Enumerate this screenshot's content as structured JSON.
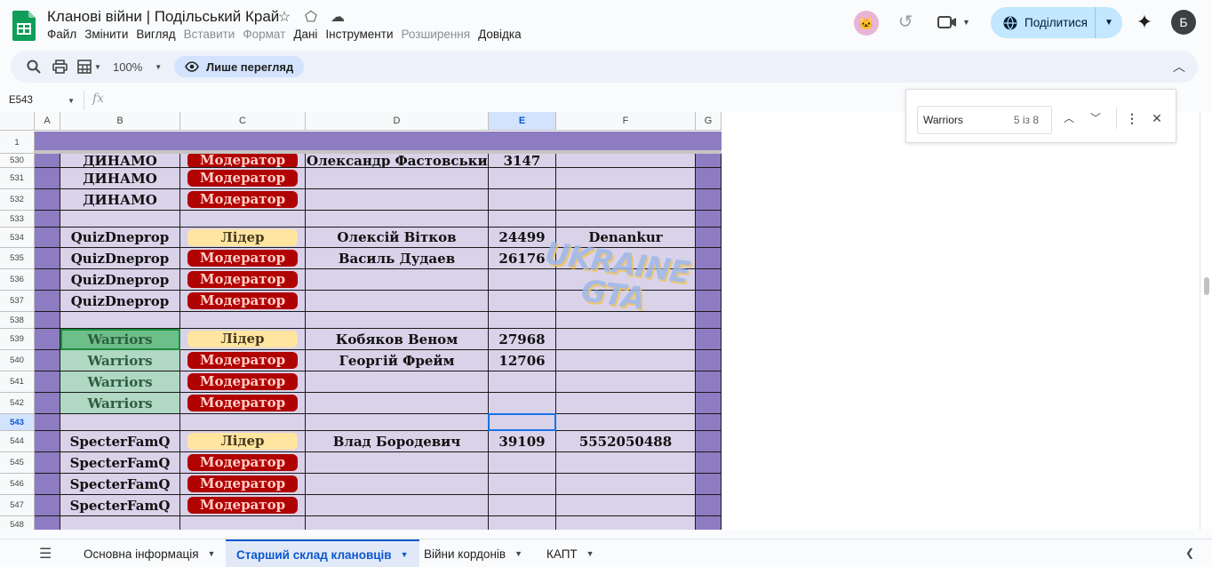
{
  "header": {
    "title": "Кланові війни | Подільський Край",
    "menu": [
      {
        "label": "Файл",
        "enabled": true
      },
      {
        "label": "Змінити",
        "enabled": true
      },
      {
        "label": "Вигляд",
        "enabled": true
      },
      {
        "label": "Вставити",
        "enabled": false
      },
      {
        "label": "Формат",
        "enabled": false
      },
      {
        "label": "Дані",
        "enabled": true
      },
      {
        "label": "Інструменти",
        "enabled": true
      },
      {
        "label": "Розширення",
        "enabled": false
      },
      {
        "label": "Довідка",
        "enabled": true
      }
    ],
    "share_label": "Поділитися",
    "user_initial": "Б"
  },
  "toolbar": {
    "zoom": "100%",
    "view_only_label": "Лише перегляд"
  },
  "formula_bar": {
    "name_box": "E543",
    "fx_label": "fx"
  },
  "find": {
    "query": "Warriors",
    "count": "5 із 8"
  },
  "grid": {
    "columns": [
      "A",
      "B",
      "C",
      "D",
      "E",
      "F",
      "G"
    ],
    "selected_column": "E",
    "frozen_row_label": "1",
    "rows": [
      {
        "num": "530",
        "b": "ДИНАМО",
        "c": "Модератор",
        "d": "Олександр Фастовський",
        "e": "3147",
        "f": ""
      },
      {
        "num": "531",
        "b": "ДИНАМО",
        "c": "Модератор",
        "d": "",
        "e": "",
        "f": ""
      },
      {
        "num": "532",
        "b": "ДИНАМО",
        "c": "Модератор",
        "d": "",
        "e": "",
        "f": ""
      },
      {
        "num": "533",
        "b": "",
        "c": "",
        "d": "",
        "e": "",
        "f": ""
      },
      {
        "num": "534",
        "b": "QuizDneprop",
        "c": "Лідер",
        "d": "Олексій Вітков",
        "e": "24499",
        "f": "Denankur"
      },
      {
        "num": "535",
        "b": "QuizDneprop",
        "c": "Модератор",
        "d": "Василь Дудаев",
        "e": "26176",
        "f": ""
      },
      {
        "num": "536",
        "b": "QuizDneprop",
        "c": "Модератор",
        "d": "",
        "e": "",
        "f": ""
      },
      {
        "num": "537",
        "b": "QuizDneprop",
        "c": "Модератор",
        "d": "",
        "e": "",
        "f": ""
      },
      {
        "num": "538",
        "b": "",
        "c": "",
        "d": "",
        "e": "",
        "f": ""
      },
      {
        "num": "539",
        "b": "Warriors",
        "c": "Лідер",
        "d": "Кобяков Веном",
        "e": "27968",
        "f": ""
      },
      {
        "num": "540",
        "b": "Warriors",
        "c": "Модератор",
        "d": "Георгій Фрейм",
        "e": "12706",
        "f": ""
      },
      {
        "num": "541",
        "b": "Warriors",
        "c": "Модератор",
        "d": "",
        "e": "",
        "f": ""
      },
      {
        "num": "542",
        "b": "Warriors",
        "c": "Модератор",
        "d": "",
        "e": "",
        "f": ""
      },
      {
        "num": "543",
        "b": "",
        "c": "",
        "d": "",
        "e": "",
        "f": ""
      },
      {
        "num": "544",
        "b": "SpecterFamQ",
        "c": "Лідер",
        "d": "Влад Бородевич",
        "e": "39109",
        "f": "5552050488"
      },
      {
        "num": "545",
        "b": "SpecterFamQ",
        "c": "Модератор",
        "d": "",
        "e": "",
        "f": ""
      },
      {
        "num": "546",
        "b": "SpecterFamQ",
        "c": "Модератор",
        "d": "",
        "e": "",
        "f": ""
      },
      {
        "num": "547",
        "b": "SpecterFamQ",
        "c": "Модератор",
        "d": "",
        "e": "",
        "f": ""
      },
      {
        "num": "548",
        "b": "",
        "c": "",
        "d": "",
        "e": "",
        "f": ""
      }
    ],
    "selected_row": "543",
    "find_matches": [
      "539",
      "540",
      "541",
      "542"
    ],
    "current_match": "539",
    "watermark": "UKRAINE GTA"
  },
  "colors": {
    "edge_purple": "#8e7cc3",
    "cell_lavender": "#d9d2e9",
    "moderator_bg": "#b10202",
    "leader_bg": "#ffe5a0",
    "match_highlight": "#b0d8c3"
  },
  "sheet_tabs": [
    {
      "label": "Основна інформація",
      "active": false
    },
    {
      "label": "Старший склад клановців",
      "active": true
    },
    {
      "label": "Війни кордонів",
      "active": false
    },
    {
      "label": "КАПТ",
      "active": false
    }
  ]
}
